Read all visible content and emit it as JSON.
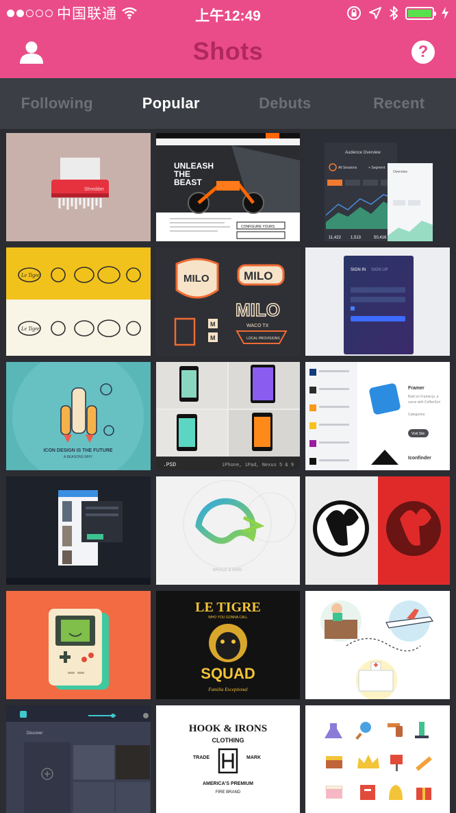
{
  "status_bar": {
    "carrier": "中国联通",
    "time": "上午12:49",
    "signal_bars_filled": 2,
    "signal_bars_total": 5,
    "battery_level": 1.0
  },
  "nav": {
    "title": "Shots",
    "left_icon": "profile-icon",
    "right_icon": "help-icon",
    "help_glyph": "?"
  },
  "tabs": [
    {
      "label": "Following",
      "active": false
    },
    {
      "label": "Popular",
      "active": true
    },
    {
      "label": "Debuts",
      "active": false
    },
    {
      "label": "Recent",
      "active": false
    }
  ],
  "shots": {
    "s1": {
      "text": "Shredder"
    },
    "s2": {
      "headline1": "UNLEASH",
      "headline2": "THE",
      "headline3": "BEAST",
      "button": "CONFIGURE YOURS"
    },
    "s3": {
      "title": "Audience Overview",
      "title2": "Overview",
      "segment1": "All Sessions",
      "segment2": "+ Segment",
      "stat1": "11,422",
      "stat2": "1,513",
      "stat3": "50,416"
    },
    "s4": {
      "brand": "Le Tigre"
    },
    "s5": {
      "brand": "MILO",
      "sub": "WACO TX",
      "tag": "LOCAL PROVISIONS",
      "m": "M"
    },
    "s6": {
      "tab1": "SIGN IN",
      "tab2": "SIGN UP"
    },
    "s7": {
      "line1": "ICON DESIGN IS THE FUTURE",
      "line2": "A REASONS WHY"
    },
    "s8": {
      "label": ".PSD",
      "devices": "iPhone, iPad, Nexus 5 & 9"
    },
    "s9": {
      "title1": "Framer",
      "desc1": "Built on Framer.js, a",
      "desc2": "curve with CoffeeScri",
      "category": "Categories:",
      "button": "Visit Site",
      "title2": "Iconfinder"
    },
    "s10": {},
    "s11": {
      "caption": "WHALE & BIRD"
    },
    "s12": {},
    "s13": {},
    "s14": {
      "title1": "LE TIGRE",
      "title2": "SQUAD",
      "script": "Familia Exceptional",
      "sub": "WHO YOU GONNA CALL"
    },
    "s15": {},
    "s16": {
      "label": "Discover"
    },
    "s17": {
      "line1": "HOOK & IRONS",
      "line2": "CLOTHING",
      "trade": "TRADE",
      "mark": "MARK",
      "premium": "AMERICA'S PREMIUM",
      "fire": "FIRE BRAND"
    },
    "s18": {}
  },
  "colors": {
    "brand_pink": "#ea4c89",
    "title_pink": "#b0295d",
    "tab_bar": "#3b3e44",
    "tab_inactive": "#6d7076",
    "background": "#2b2d33"
  }
}
